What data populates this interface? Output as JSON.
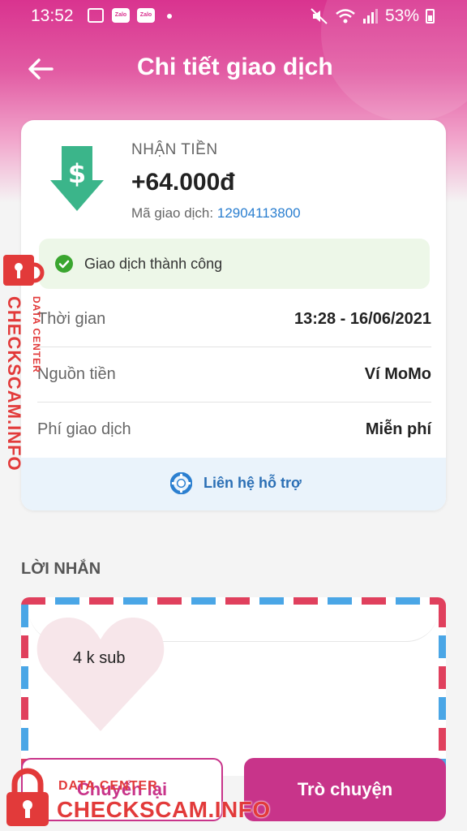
{
  "status_bar": {
    "time": "13:52",
    "notification_icons": [
      "image-icon",
      "zalo-icon",
      "zalo-icon"
    ],
    "zalo_label": "Zalo",
    "battery": "53%"
  },
  "header": {
    "title": "Chi tiết giao dịch"
  },
  "transaction": {
    "type": "NHẬN TIỀN",
    "amount": "+64.000đ",
    "id_label": "Mã giao dịch:",
    "id_value": "12904113800",
    "status": "Giao dịch thành công",
    "rows": [
      {
        "label": "Thời gian",
        "value": "13:28 - 16/06/2021"
      },
      {
        "label": "Nguồn tiền",
        "value": "Ví MoMo"
      },
      {
        "label": "Phí giao dịch",
        "value": "Miễn phí"
      }
    ],
    "support_label": "Liên hệ hỗ trợ"
  },
  "message": {
    "heading": "LỜI NHẮN",
    "text": "4 k sub"
  },
  "actions": {
    "resend_label": "Chuyển lại",
    "chat_label": "Trò chuyện"
  },
  "watermark": {
    "site_vertical": "CHECKSCAM.INFO",
    "data_center_vertical": "DATA CENTER",
    "data_center": "DATA CENTER",
    "site": "CHECKSCAM.INFO"
  },
  "colors": {
    "brand": "#c8348a",
    "link": "#2b7fd0",
    "success": "#3aa62f",
    "watermark": "#e23a3a"
  }
}
